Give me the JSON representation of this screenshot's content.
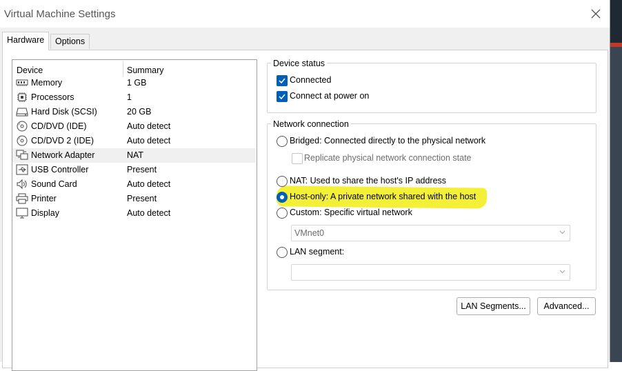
{
  "window": {
    "title": "Virtual Machine Settings"
  },
  "tabs": {
    "hardware": "Hardware",
    "options": "Options"
  },
  "device_list": {
    "columns": {
      "device": "Device",
      "summary": "Summary"
    },
    "items": [
      {
        "name": "Memory",
        "summary": "1 GB",
        "icon": "memory-icon"
      },
      {
        "name": "Processors",
        "summary": "1",
        "icon": "processor-icon"
      },
      {
        "name": "Hard Disk (SCSI)",
        "summary": "20 GB",
        "icon": "hard-disk-icon"
      },
      {
        "name": "CD/DVD (IDE)",
        "summary": "Auto detect",
        "icon": "cd-dvd-icon"
      },
      {
        "name": "CD/DVD 2 (IDE)",
        "summary": "Auto detect",
        "icon": "cd-dvd-icon"
      },
      {
        "name": "Network Adapter",
        "summary": "NAT",
        "icon": "network-adapter-icon",
        "selected": true
      },
      {
        "name": "USB Controller",
        "summary": "Present",
        "icon": "usb-icon"
      },
      {
        "name": "Sound Card",
        "summary": "Auto detect",
        "icon": "sound-card-icon"
      },
      {
        "name": "Printer",
        "summary": "Present",
        "icon": "printer-icon"
      },
      {
        "name": "Display",
        "summary": "Auto detect",
        "icon": "display-icon"
      }
    ]
  },
  "device_status": {
    "title": "Device status",
    "connected": {
      "label": "Connected",
      "checked": true
    },
    "connect_at_power_on": {
      "label": "Connect at power on",
      "checked": true
    }
  },
  "network_connection": {
    "title": "Network connection",
    "bridged": {
      "label": "Bridged: Connected directly to the physical network",
      "selected": false
    },
    "replicate": {
      "label": "Replicate physical network connection state",
      "checked": false,
      "enabled": false
    },
    "nat": {
      "label": "NAT: Used to share the host's IP address",
      "selected": false
    },
    "host_only": {
      "label": "Host-only: A private network shared with the host",
      "selected": true
    },
    "custom": {
      "label": "Custom: Specific virtual network",
      "selected": false
    },
    "vmnet_select": {
      "value": "VMnet0",
      "enabled": false
    },
    "lan_segment": {
      "label": "LAN segment:",
      "selected": false
    },
    "lan_segment_select": {
      "value": "",
      "enabled": false
    }
  },
  "buttons": {
    "lan_segments": "LAN Segments...",
    "advanced": "Advanced..."
  },
  "colors": {
    "accent": "#005fb8",
    "highlight": "#f4f038"
  }
}
